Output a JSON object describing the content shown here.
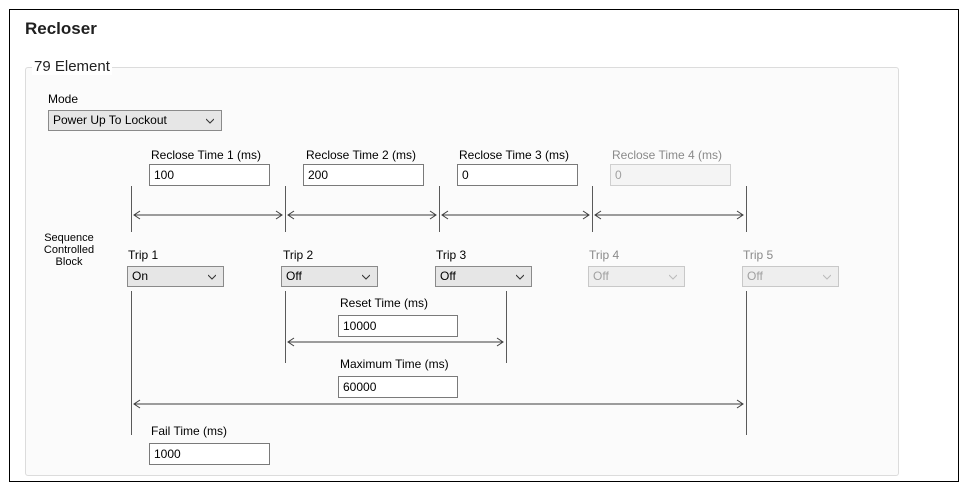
{
  "page": {
    "title": "Recloser"
  },
  "group": {
    "legend": "79 Element"
  },
  "mode": {
    "label": "Mode",
    "value": "Power Up To Lockout"
  },
  "side_label": {
    "line1": "Sequence",
    "line2": "Controlled",
    "line3": "Block"
  },
  "reclose_times": [
    {
      "label": "Reclose Time 1 (ms)",
      "value": "100",
      "enabled": true
    },
    {
      "label": "Reclose Time 2 (ms)",
      "value": "200",
      "enabled": true
    },
    {
      "label": "Reclose Time 3 (ms)",
      "value": "0",
      "enabled": true
    },
    {
      "label": "Reclose Time 4 (ms)",
      "value": "0",
      "enabled": false
    }
  ],
  "trips": [
    {
      "label": "Trip 1",
      "value": "On",
      "enabled": true
    },
    {
      "label": "Trip 2",
      "value": "Off",
      "enabled": true
    },
    {
      "label": "Trip 3",
      "value": "Off",
      "enabled": true
    },
    {
      "label": "Trip 4",
      "value": "Off",
      "enabled": false
    },
    {
      "label": "Trip 5",
      "value": "Off",
      "enabled": false
    }
  ],
  "reset_time": {
    "label": "Reset Time (ms)",
    "value": "10000"
  },
  "maximum_time": {
    "label": "Maximum Time (ms)",
    "value": "60000"
  },
  "fail_time": {
    "label": "Fail Time (ms)",
    "value": "1000"
  },
  "icons": {
    "dropdown": "chevron-down-icon",
    "timeline_arrow": "double-arrow-icon"
  }
}
